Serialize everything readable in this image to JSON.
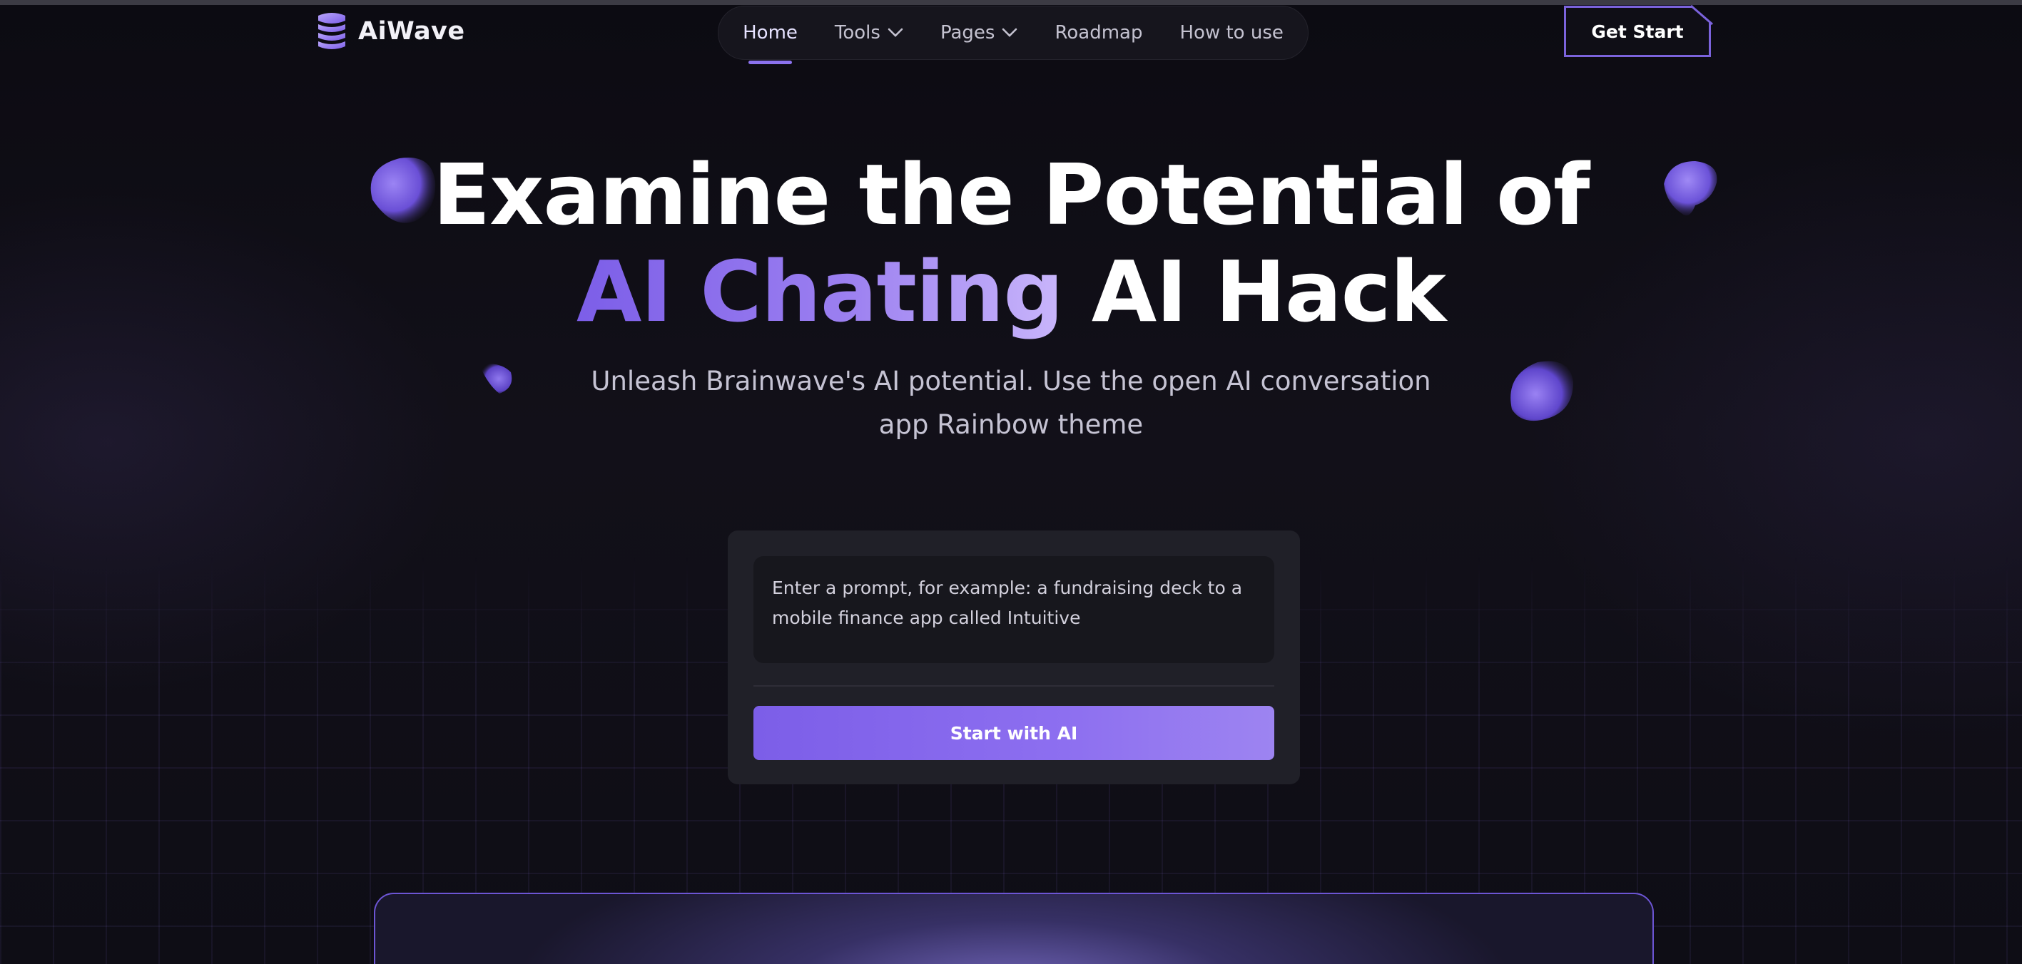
{
  "brand": {
    "name": "AiWave",
    "accent": "#7c5ee8"
  },
  "nav": {
    "items": [
      {
        "label": "Home",
        "active": true,
        "dropdown": false
      },
      {
        "label": "Tools",
        "active": false,
        "dropdown": true
      },
      {
        "label": "Pages",
        "active": false,
        "dropdown": true
      },
      {
        "label": "Roadmap",
        "active": false,
        "dropdown": false
      },
      {
        "label": "How to use",
        "active": false,
        "dropdown": false
      }
    ],
    "cta_label": "Get Start"
  },
  "hero": {
    "line1": "Examine the Potential of",
    "highlight": "AI Chating",
    "line2_rest": "AI Hack",
    "subtitle": "Unleash Brainwave's AI potential. Use the open AI conversation app Rainbow theme"
  },
  "prompt": {
    "placeholder": "Enter a prompt, for example: a fundraising deck to a mobile finance app called Intuitive",
    "button_label": "Start with AI"
  },
  "colors": {
    "background": "#0d0c13",
    "card": "#202028",
    "input": "#17171d",
    "accent_light": "#c9b6fb"
  }
}
